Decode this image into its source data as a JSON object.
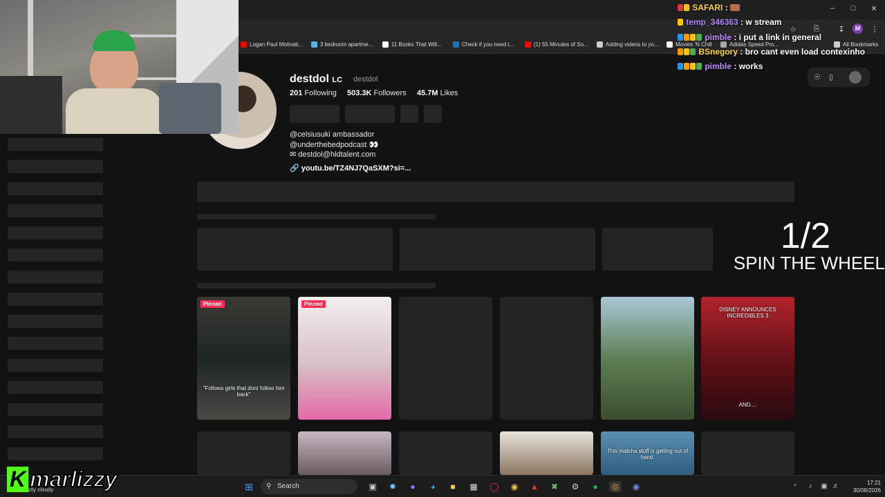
{
  "bookmarks": [
    {
      "label": "Logan Paul Motivati...",
      "color": "#ff0000"
    },
    {
      "label": "3 bedroom apartme...",
      "color": "#5ab0e8"
    },
    {
      "label": "11 Books That Will...",
      "color": "#ffffff"
    },
    {
      "label": "Check if you need t...",
      "color": "#1d70b8"
    },
    {
      "label": "(1) 55 Minutes of So...",
      "color": "#ff0000"
    },
    {
      "label": "Adding videos to yo...",
      "color": "#cccccc"
    },
    {
      "label": "Movies 'N Chill",
      "color": "#ffffff"
    },
    {
      "label": "Adidas Speed Pro...",
      "color": "#aaaaaa"
    },
    {
      "label": "All Bookmarks",
      "color": "#cccccc"
    }
  ],
  "profile": {
    "display_name": "destdol",
    "name_suffix": "LC",
    "handle": "destdol",
    "following_count": "201",
    "following_label": "Following",
    "followers_count": "503.3K",
    "followers_label": "Followers",
    "likes_count": "45.7M",
    "likes_label": "Likes",
    "bio_line_1": "@celsiusuki ambassador",
    "bio_line_2": "@underthebedpodcast 👀",
    "bio_email": "destdol@hldtalent.com",
    "bio_link": "youtu.be/TZ4NJ7QaSXM?si=..."
  },
  "videos": [
    {
      "pinned": "Pinned",
      "caption": "\"Follows girls that dont follow him back\"",
      "loaded": true,
      "bg": "#2a2a26"
    },
    {
      "pinned": "Pinned",
      "caption": "",
      "loaded": true,
      "bg": "#d8c0c6"
    },
    {
      "pinned": "",
      "caption": "",
      "loaded": false,
      "bg": "#242424"
    },
    {
      "pinned": "",
      "caption": "",
      "loaded": false,
      "bg": "#242424"
    },
    {
      "pinned": "",
      "caption": "",
      "loaded": true,
      "bg": "#6f8f9c"
    },
    {
      "pinned": "",
      "caption": "DISNEY ANNOUNCES INCREDIBLES 3",
      "caption2": "AND....",
      "loaded": true,
      "bg": "#8c1d24"
    }
  ],
  "videos_row2": [
    {
      "caption": "",
      "loaded": false
    },
    {
      "caption": "",
      "loaded": true
    },
    {
      "caption": "",
      "loaded": false
    },
    {
      "caption": "",
      "loaded": true
    },
    {
      "caption": "This matcha stuff is getting out of hand.",
      "loaded": true
    },
    {
      "caption": "",
      "loaded": false
    }
  ],
  "chat": [
    {
      "user": "SAFARI",
      "message": "",
      "color": "#ffd54a"
    },
    {
      "user": "temp_346363",
      "message": "w stream",
      "color": "#b084ff"
    },
    {
      "user": "pimble",
      "message": "i put a link in general",
      "color": "#c18cff"
    },
    {
      "user": "BSnegory",
      "message": "bro cant even load contexinho",
      "color": "#ffd54a"
    },
    {
      "user": "pimble",
      "message": "works",
      "color": "#c18cff"
    }
  ],
  "spin": {
    "fraction": "1/2",
    "label": "SPIN THE WHEEL"
  },
  "streamer": {
    "name": "marlizzy",
    "badge": "K",
    "accent": "#53fc18"
  },
  "taskbar": {
    "search_label": "Search",
    "weather": "stly cloudy",
    "time": "17:21",
    "date": "30/08/2026"
  }
}
